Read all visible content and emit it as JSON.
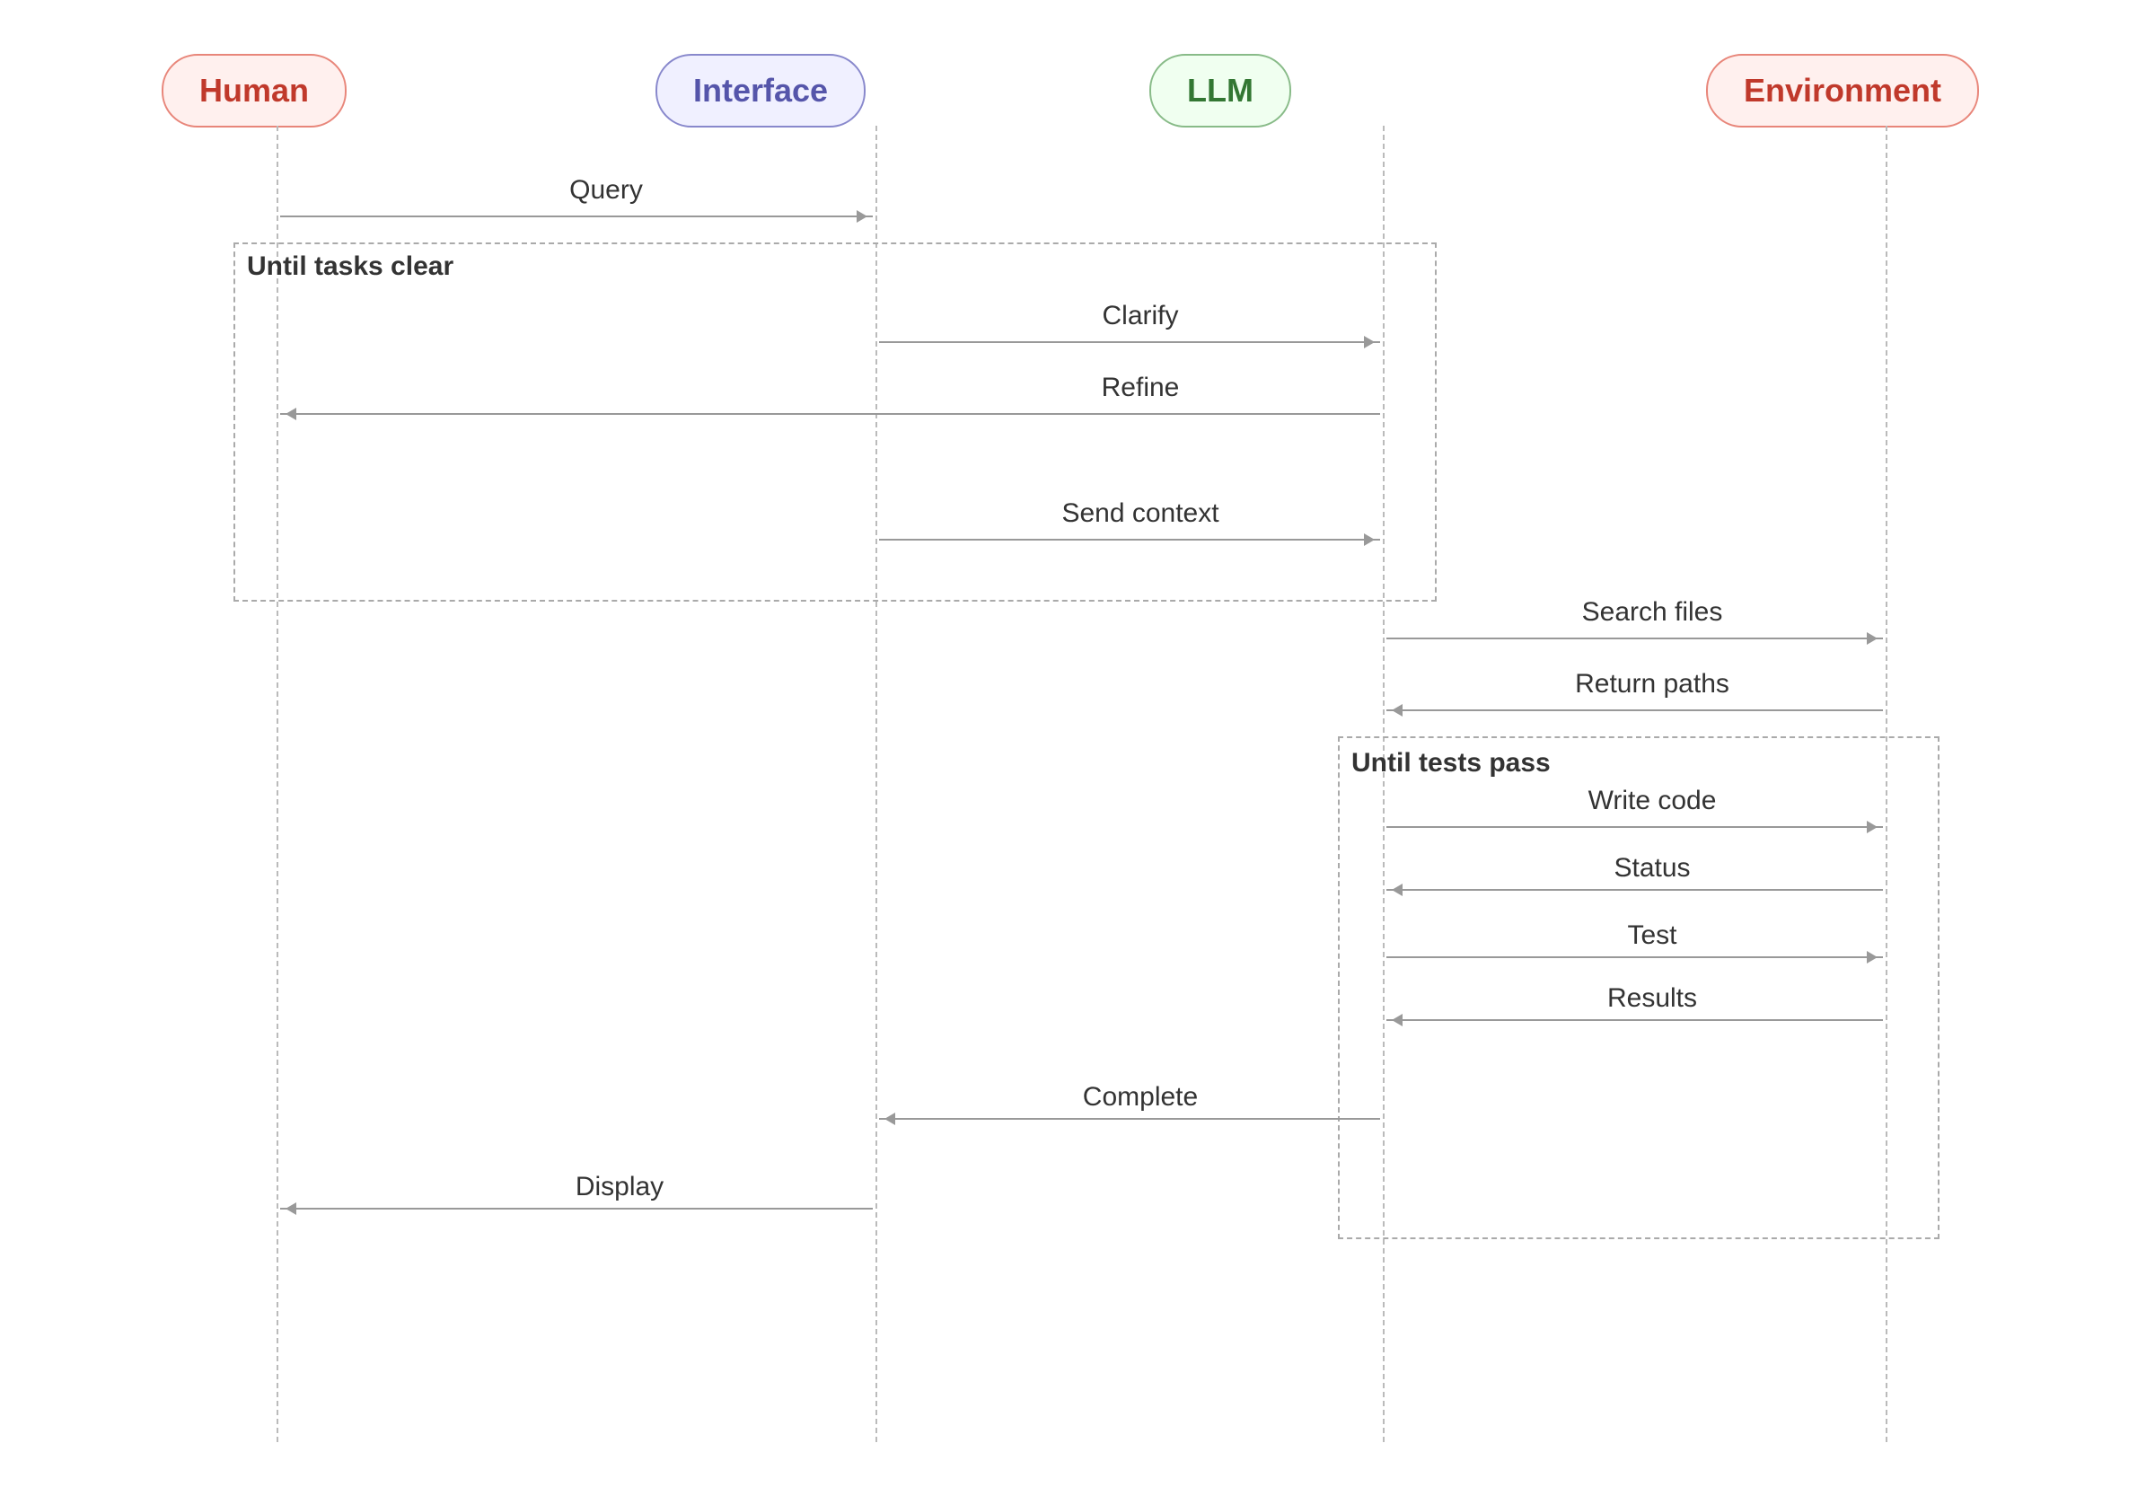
{
  "actors": {
    "human": {
      "label": "Human"
    },
    "interface": {
      "label": "Interface"
    },
    "llm": {
      "label": "LLM"
    },
    "environment": {
      "label": "Environment"
    }
  },
  "loops": {
    "loop1": {
      "label": "Until tasks clear"
    },
    "loop2": {
      "label": "Until tests pass"
    }
  },
  "arrows": {
    "query": "Query",
    "clarify": "Clarify",
    "refine": "Refine",
    "send_context": "Send context",
    "search_files": "Search files",
    "return_paths": "Return paths",
    "write_code": "Write code",
    "status": "Status",
    "test": "Test",
    "results": "Results",
    "complete": "Complete",
    "display": "Display"
  }
}
